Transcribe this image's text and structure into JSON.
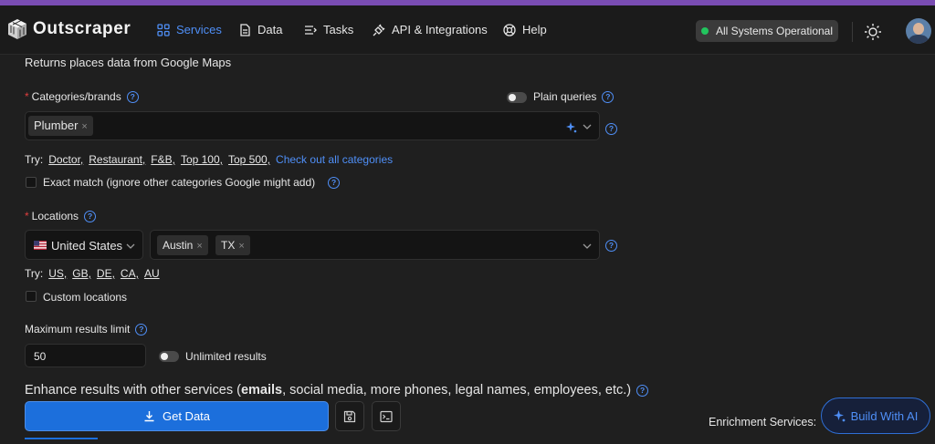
{
  "nav": {
    "logo_text": "Outscraper",
    "items": [
      {
        "label": "Services",
        "icon": "grid-icon",
        "active": true
      },
      {
        "label": "Data",
        "icon": "document-icon"
      },
      {
        "label": "Tasks",
        "icon": "list-icon"
      },
      {
        "label": "API & Integrations",
        "icon": "plug-icon"
      },
      {
        "label": "Help",
        "icon": "lifebuoy-icon"
      }
    ],
    "status": "All Systems Operational",
    "status_color": "#22c55e",
    "accent": "#4f8ff7"
  },
  "form": {
    "description": "Returns places data from Google Maps",
    "categories": {
      "label": "Categories/brands",
      "plain_queries_label": "Plain queries",
      "tags": [
        "Plumber"
      ],
      "try_prefix": "Try:",
      "try_items": [
        "Doctor,",
        "Restaurant,",
        "F&B,",
        "Top 100,",
        "Top 500,"
      ],
      "check_all": "Check out all categories",
      "exact_match": "Exact match (ignore other categories Google might add)"
    },
    "locations": {
      "label": "Locations",
      "country": "United States",
      "tags": [
        "Austin",
        "TX"
      ],
      "try_prefix": "Try:",
      "try_items": [
        "US,",
        "GB,",
        "DE,",
        "CA,",
        "AU"
      ],
      "custom_locations": "Custom locations"
    },
    "limit": {
      "label": "Maximum results limit",
      "value": "50",
      "unlimited_label": "Unlimited results"
    },
    "enhance": {
      "prefix": "Enhance results with other services (",
      "bold": "emails",
      "suffix": ", social media, more phones, legal names, employees, etc.)"
    }
  },
  "actions": {
    "get_data": "Get Data",
    "enrichment_label": "Enrichment Services:",
    "build_ai": "Build With AI"
  }
}
